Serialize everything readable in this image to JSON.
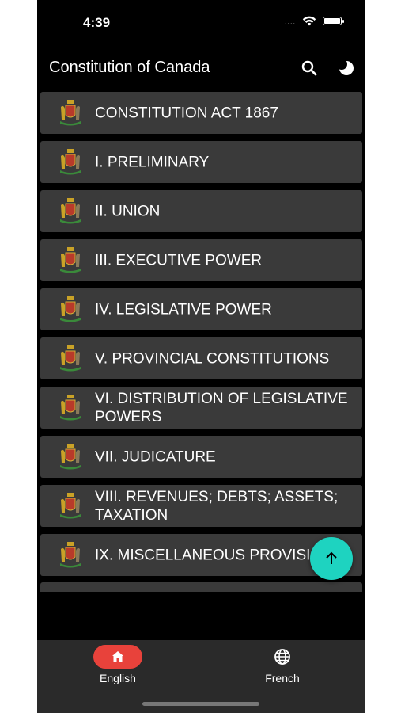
{
  "status_bar": {
    "time": "4:39",
    "signal": "....",
    "icons": [
      "wifi-icon",
      "battery-icon"
    ]
  },
  "app_bar": {
    "title": "Constitution of Canada",
    "icons": [
      "search-icon",
      "moon-icon"
    ]
  },
  "list": {
    "items": [
      {
        "label": "CONSTITUTION ACT 1867"
      },
      {
        "label": "I. PRELIMINARY"
      },
      {
        "label": "II. UNION"
      },
      {
        "label": "III. EXECUTIVE POWER"
      },
      {
        "label": "IV. LEGISLATIVE POWER"
      },
      {
        "label": "V. PROVINCIAL CONSTITUTIONS"
      },
      {
        "label": "VI. DISTRIBUTION OF LEGISLATIVE POWERS"
      },
      {
        "label": "VII. JUDICATURE"
      },
      {
        "label": "VIII. REVENUES; DEBTS; ASSETS; TAXATION"
      },
      {
        "label": "IX. MISCELLANEOUS PROVISIONS"
      }
    ],
    "item_icon": "coat-of-arms-icon"
  },
  "fab": {
    "icon": "arrow-up-icon"
  },
  "bottom_nav": {
    "tabs": [
      {
        "label": "English",
        "icon": "home-icon",
        "active": true
      },
      {
        "label": "French",
        "icon": "globe-icon",
        "active": false
      }
    ]
  },
  "colors": {
    "background": "#000000",
    "list_item": "#3a3a3a",
    "fab": "#1ed3c0",
    "active_tab": "#e8423b",
    "nav_bar": "#2a2a2a"
  }
}
